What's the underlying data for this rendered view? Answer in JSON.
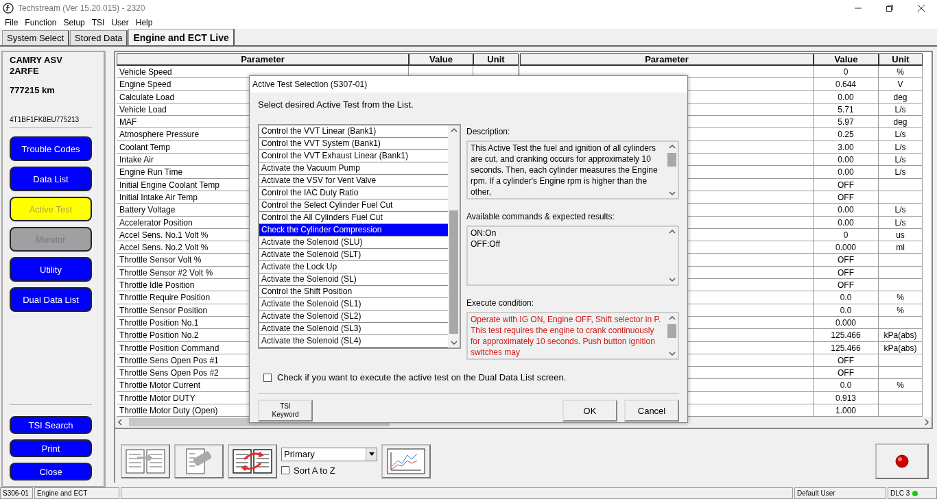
{
  "window": {
    "title": "Techstream (Ver 15.20.015) - 2320"
  },
  "menu": [
    "File",
    "Function",
    "Setup",
    "TSI",
    "User",
    "Help"
  ],
  "tabs": [
    {
      "label": "System Select",
      "selected": false
    },
    {
      "label": "Stored Data",
      "selected": false
    },
    {
      "label": "Engine and ECT Live",
      "selected": true
    }
  ],
  "vehicle": {
    "model": "CAMRY ASV",
    "engine": "2ARFE",
    "odometer": "777215 km",
    "vin": "4T1BF1FK8EU775213"
  },
  "nav_buttons": [
    {
      "label": "Trouble Codes",
      "kind": "normal"
    },
    {
      "label": "Data List",
      "kind": "normal"
    },
    {
      "label": "Active Test",
      "kind": "active"
    },
    {
      "label": "Monitor",
      "kind": "disabled"
    },
    {
      "label": "Utility",
      "kind": "normal"
    },
    {
      "label": "Dual Data List",
      "kind": "normal"
    }
  ],
  "bottom_buttons": [
    "TSI Search",
    "Print",
    "Close"
  ],
  "table": {
    "columns": [
      "Parameter",
      "Value",
      "Unit",
      "Parameter",
      "Value",
      "Unit"
    ],
    "left_rows": [
      "Vehicle Speed",
      "Engine Speed",
      "Calculate Load",
      "Vehicle Load",
      "MAF",
      "Atmosphere Pressure",
      "Coolant Temp",
      "Intake Air",
      "Engine Run Time",
      "Initial Engine Coolant Temp",
      "Initial Intake Air Temp",
      "Battery Voltage",
      "Accelerator Position",
      "Accel Sens. No.1 Volt %",
      "Accel Sens. No.2 Volt %",
      "Throttle Sensor Volt %",
      "Throttle Sensor #2 Volt %",
      "Throttle Idle Position",
      "Throttle Require Position",
      "Throttle Sensor Position",
      "Throttle Position No.1",
      "Throttle Position No.2",
      "Throttle Position Command",
      "Throttle Sens Open Pos #1",
      "Throttle Sens Open Pos #2",
      "Throttle Motor Current",
      "Throttle Motor DUTY",
      "Throttle Motor Duty (Open)"
    ],
    "right_rows": [
      {
        "value": "0",
        "unit": "%"
      },
      {
        "value": "0.644",
        "unit": "V"
      },
      {
        "value": "0.00",
        "unit": "deg"
      },
      {
        "value": "5.71",
        "unit": "L/s"
      },
      {
        "value": "5.97",
        "unit": "deg"
      },
      {
        "value": "0.25",
        "unit": "L/s"
      },
      {
        "value": "3.00",
        "unit": "L/s"
      },
      {
        "value": "0.00",
        "unit": "L/s"
      },
      {
        "value": "0.00",
        "unit": "L/s"
      },
      {
        "value": "OFF"
      },
      {
        "value": "OFF"
      },
      {
        "value": "0.00",
        "unit": "L/s"
      },
      {
        "value": "0.00",
        "unit": "L/s"
      },
      {
        "value": "0",
        "unit": "us"
      },
      {
        "value": "0.000",
        "unit": "ml"
      },
      {
        "value": "OFF"
      },
      {
        "value": "OFF"
      },
      {
        "value": "OFF"
      },
      {
        "value": "0.0",
        "unit": "%"
      },
      {
        "value": "0.0",
        "unit": "%"
      },
      {
        "value": "0.000"
      },
      {
        "value": "125.466",
        "unit": "kPa(abs)"
      },
      {
        "value": "125.466",
        "unit": "kPa(abs)"
      },
      {
        "value": "OFF"
      },
      {
        "value": "OFF"
      },
      {
        "value": "0.0",
        "unit": "%"
      },
      {
        "value": "0.913"
      },
      {
        "value": "1.000"
      }
    ]
  },
  "toolbar": {
    "dropdown": {
      "value": "Primary"
    },
    "sort": {
      "label": "Sort A to Z",
      "checked": false
    }
  },
  "status_bar": {
    "screen_id": "S306-01",
    "system": "Engine and ECT",
    "user": "Default User",
    "connection": "DLC 3"
  },
  "dialog": {
    "title": "Active Test Selection (S307-01)",
    "prompt": "Select desired Active Test from the List.",
    "tests": [
      {
        "label": "Control the VVT Linear (Bank1)",
        "selected": false
      },
      {
        "label": "Control the VVT System (Bank1)",
        "selected": false
      },
      {
        "label": "Control the VVT Exhaust Linear (Bank1)",
        "selected": false
      },
      {
        "label": "Activate the Vacuum Pump",
        "selected": false
      },
      {
        "label": "Activate the VSV for Vent Valve",
        "selected": false
      },
      {
        "label": "Control the IAC Duty Ratio",
        "selected": false
      },
      {
        "label": "Control the Select Cylinder Fuel Cut",
        "selected": false
      },
      {
        "label": "Control the All Cylinders Fuel Cut",
        "selected": false
      },
      {
        "label": "Check the Cylinder Compression",
        "selected": true
      },
      {
        "label": "Activate the Solenoid (SLU)",
        "selected": false
      },
      {
        "label": "Activate the Solenoid (SLT)",
        "selected": false
      },
      {
        "label": "Activate the Lock Up",
        "selected": false
      },
      {
        "label": "Activate the Solenoid (SL)",
        "selected": false
      },
      {
        "label": "Control the Shift Position",
        "selected": false
      },
      {
        "label": "Activate the Solenoid (SL1)",
        "selected": false
      },
      {
        "label": "Activate the Solenoid (SL2)",
        "selected": false
      },
      {
        "label": "Activate the Solenoid (SL3)",
        "selected": false
      },
      {
        "label": "Activate the Solenoid (SL4)",
        "selected": false
      }
    ],
    "description_label": "Description:",
    "description": "This Active Test the fuel and ignition of all cylinders are cut, and cranking occurs for approximately 10 seconds. Then, each cylinder measures the Engine rpm. If a cylinder's Engine rpm is higher than the other,",
    "commands_label": "Available commands & expected results:",
    "commands": [
      "ON:On",
      "OFF:Off"
    ],
    "condition_label": "Execute condition:",
    "condition": [
      "Operate with IG ON, Engine OFF, Shift selector in P.",
      "This test requires the engine to crank continuously for approximately 10 seconds.  Push button ignition switches may"
    ],
    "dual_option": {
      "label": "Check if you want to execute the active test on the Dual Data List screen.",
      "checked": false
    },
    "keyword_button": [
      "TSI",
      "Keyword"
    ],
    "ok": "OK",
    "cancel": "Cancel"
  }
}
